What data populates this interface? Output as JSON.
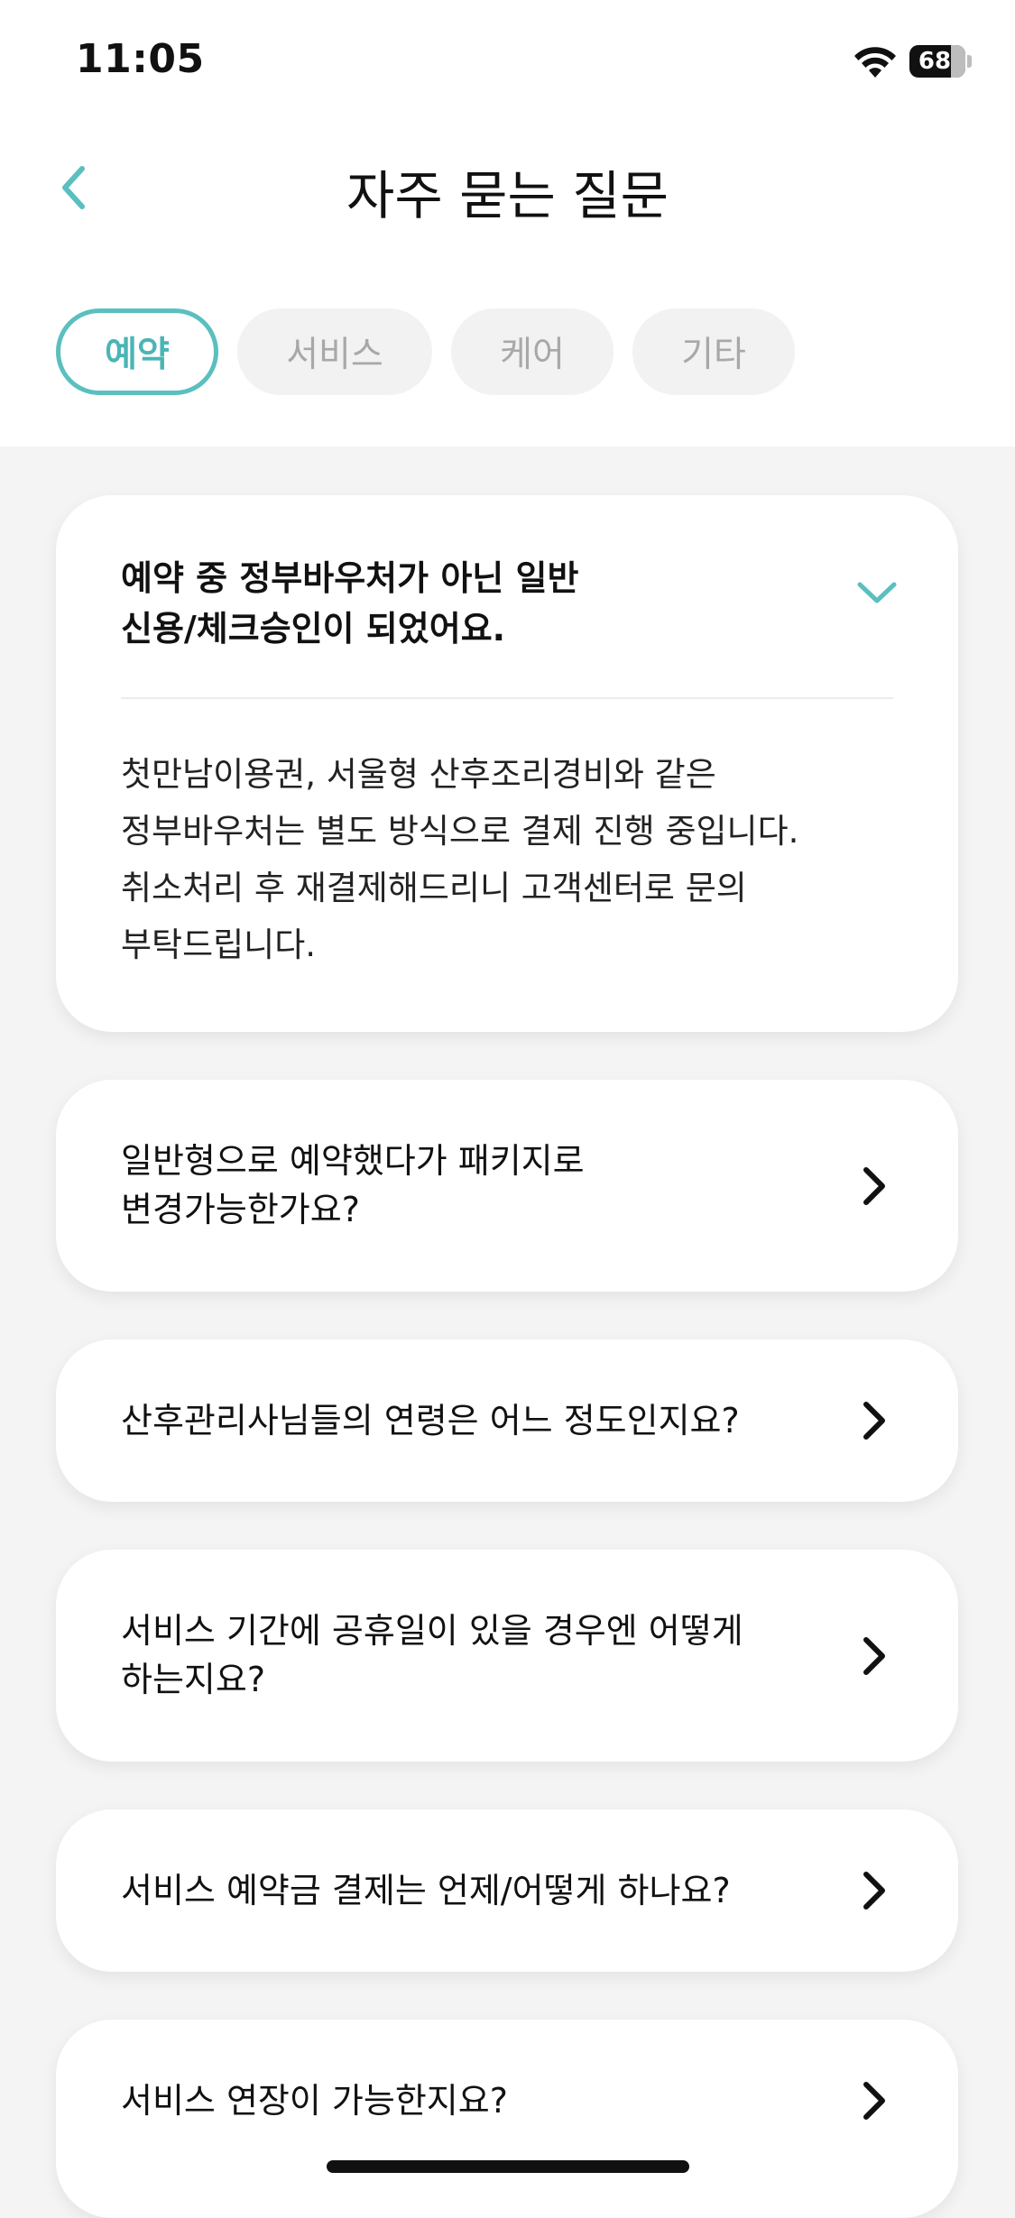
{
  "status_bar": {
    "time": "11:05",
    "battery": "68",
    "battery_level": 0.68
  },
  "header": {
    "title": "자주 묻는 질문",
    "back_icon": "chevron-left-icon"
  },
  "tabs": [
    {
      "label": "예약",
      "active": true
    },
    {
      "label": "서비스",
      "active": false
    },
    {
      "label": "케어",
      "active": false
    },
    {
      "label": "기타",
      "active": false
    }
  ],
  "colors": {
    "accent": "#5bbfbf",
    "background": "#f4f4f4",
    "card": "#ffffff",
    "tab_inactive_bg": "#f2f2f2",
    "tab_inactive_text": "#a8a8a8"
  },
  "faq": [
    {
      "question_line1": "예약 중 정부바우처가 아닌 일반",
      "question_line2": "신용/체크승인이 되었어요.",
      "expanded": true,
      "answer_lines": [
        "첫만남이용권, 서울형 산후조리경비와 같은",
        "정부바우처는 별도 방식으로 결제 진행 중입니다.",
        "취소처리 후 재결제해드리니 고객센터로 문의",
        "부탁드립니다."
      ],
      "icon": "chevron-down-icon"
    },
    {
      "question_line1": "일반형으로 예약했다가 패키지로",
      "question_line2": "변경가능한가요?",
      "expanded": false,
      "icon": "chevron-right-icon"
    },
    {
      "question_line1": "산후관리사님들의 연령은 어느 정도인지요?",
      "expanded": false,
      "icon": "chevron-right-icon"
    },
    {
      "question_line1": "서비스 기간에 공휴일이 있을 경우엔 어떻게",
      "question_line2": "하는지요?",
      "expanded": false,
      "icon": "chevron-right-icon"
    },
    {
      "question_line1": "서비스 예약금 결제는 언제/어떻게 하나요?",
      "expanded": false,
      "icon": "chevron-right-icon"
    },
    {
      "question_line1": "서비스 연장이 가능한지요?",
      "expanded": false,
      "icon": "chevron-right-icon"
    }
  ]
}
